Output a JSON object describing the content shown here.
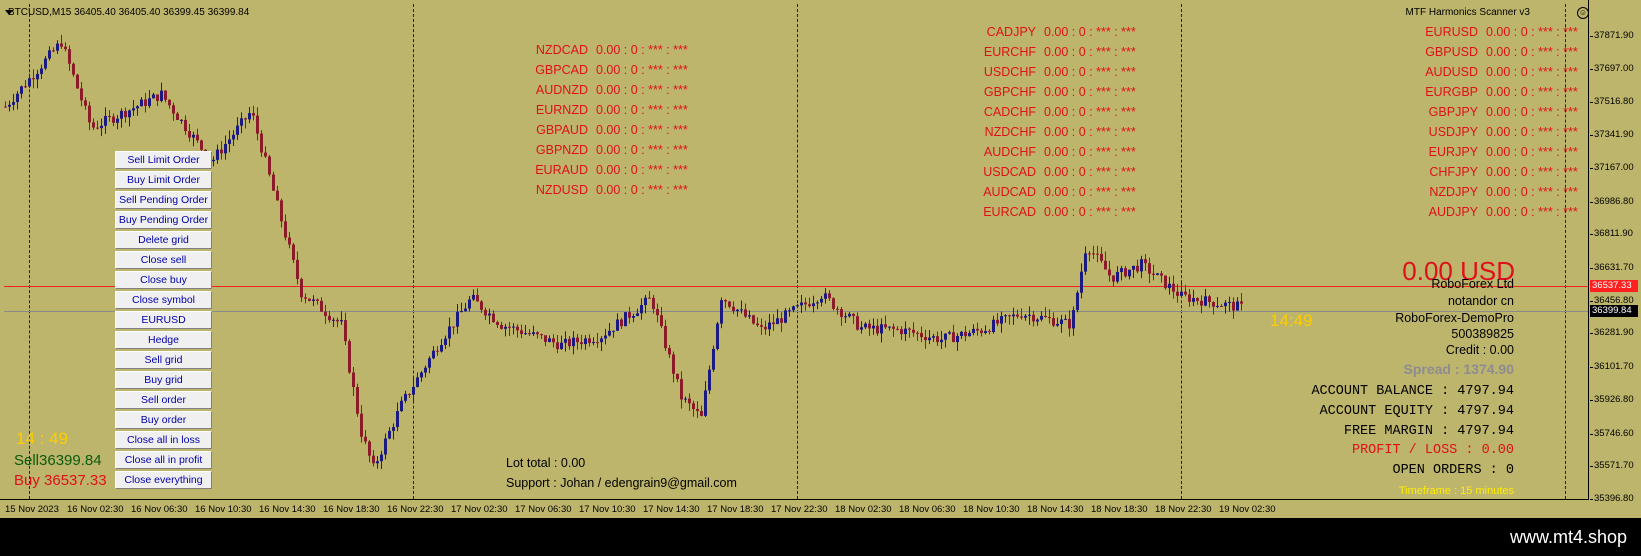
{
  "chart": {
    "symbol_title": "BTCUSD,M15  36405.40 36405.40 36399.45 36399.84",
    "indicator_title": "MTF Harmonics Scanner v3",
    "colors": {
      "background": "#bdb56b",
      "bull": "#1a1a80",
      "bear": "#8b1a2a",
      "ask_line": "#ff2020",
      "bid_line": "#8a8a8a"
    }
  },
  "y_axis": {
    "ticks": [
      "37871.90",
      "37697.00",
      "37516.80",
      "37341.90",
      "37167.00",
      "36986.80",
      "36811.90",
      "36631.70",
      "36456.80",
      "36281.90",
      "36101.70",
      "35926.80",
      "35746.60",
      "35571.70",
      "35396.80"
    ],
    "tick_values": [
      37871.9,
      37697.0,
      37516.8,
      37341.9,
      37167.0,
      36986.8,
      36811.9,
      36631.7,
      36456.8,
      36281.9,
      36101.7,
      35926.8,
      35746.6,
      35571.7,
      35396.8
    ],
    "ask_price": "36537.33",
    "bid_price": "36399.84",
    "ask_value": 36537.33,
    "bid_value": 36399.84
  },
  "x_axis": {
    "ticks": [
      "15 Nov 2023",
      "16 Nov 02:30",
      "16 Nov 06:30",
      "16 Nov 10:30",
      "16 Nov 14:30",
      "16 Nov 18:30",
      "16 Nov 22:30",
      "17 Nov 02:30",
      "17 Nov 06:30",
      "17 Nov 10:30",
      "17 Nov 14:30",
      "17 Nov 18:30",
      "17 Nov 22:30",
      "18 Nov 02:30",
      "18 Nov 06:30",
      "18 Nov 10:30",
      "18 Nov 14:30",
      "18 Nov 18:30",
      "18 Nov 22:30",
      "19 Nov 02:30"
    ]
  },
  "scanner": {
    "zero_text": "0.00 : 0 : *** : ***",
    "col1": [
      "NZDCAD",
      "GBPCAD",
      "AUDNZD",
      "EURNZD",
      "GBPAUD",
      "GBPNZD",
      "EURAUD",
      "NZDUSD"
    ],
    "col2": [
      "CADJPY",
      "EURCHF",
      "USDCHF",
      "GBPCHF",
      "CADCHF",
      "NZDCHF",
      "AUDCHF",
      "USDCAD",
      "AUDCAD",
      "EURCAD"
    ],
    "col3": [
      "EURUSD",
      "GBPUSD",
      "AUDUSD",
      "EURGBP",
      "GBPJPY",
      "USDJPY",
      "EURJPY",
      "CHFJPY",
      "NZDJPY",
      "AUDJPY"
    ]
  },
  "menu": {
    "buttons": [
      "Sell Limit Order",
      "Buy Limit Order",
      "Sell Pending Order",
      "Buy Pending Order",
      "Delete grid",
      "Close sell",
      "Close buy",
      "Close symbol",
      "EURUSD",
      "Hedge",
      "Sell grid",
      "Buy grid",
      "Sell order",
      "Buy order",
      "Close all in loss",
      "Close all in profit",
      "Close everything"
    ]
  },
  "left_panel": {
    "timer": "14 : 49",
    "sell": "Sell36399.84",
    "buy": "Buy 36537.33"
  },
  "bottom_text": {
    "lot_total": "Lot total : 0.00",
    "support": "Support : Johan / edengrain9@gmail.com"
  },
  "right_panel": {
    "timer": "14:49",
    "profit_usd": "0.00 USD",
    "broker": "RoboForex Ltd",
    "name": "notandor cn",
    "server": "RoboForex-DemoPro",
    "account_number": "500389825",
    "credit": "Credit : 0.00",
    "spread": "Spread : 1374.90",
    "balance": "ACCOUNT BALANCE : 4797.94",
    "equity": "ACCOUNT EQUITY : 4797.94",
    "free_margin": "FREE MARGIN : 4797.94",
    "profit_loss": "PROFIT / LOSS : 0.00",
    "open_orders": "OPEN ORDERS : 0",
    "timeframe": "Timeframe : 15 minutes"
  },
  "footer": {
    "brand": "www.mt4.shop"
  }
}
